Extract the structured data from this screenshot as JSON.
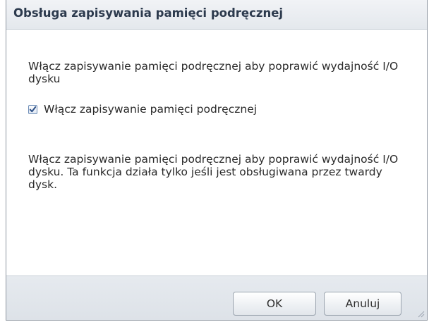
{
  "dialog": {
    "title": "Obsługa zapisywania pamięci podręcznej",
    "intro": "Włącz zapisywanie pamięci podręcznej aby poprawić wydajność I/O dysku",
    "checkbox": {
      "label": "Włącz zapisywanie pamięci podręcznej",
      "checked": true
    },
    "description": "Włącz zapisywanie pamięci podręcznej aby poprawić wydajność I/O dysku. Ta funkcja działa tylko jeśli jest obsługiwana przez twardy dysk.",
    "buttons": {
      "ok_label": "OK",
      "cancel_label": "Anuluj"
    }
  },
  "colors": {
    "title_text": "#2c3a4d",
    "checkmark": "#2b4f86",
    "body_text": "#2a2a2a"
  },
  "icons": {
    "checkbox": "checkmark-icon",
    "resize": "resize-grip-icon"
  }
}
